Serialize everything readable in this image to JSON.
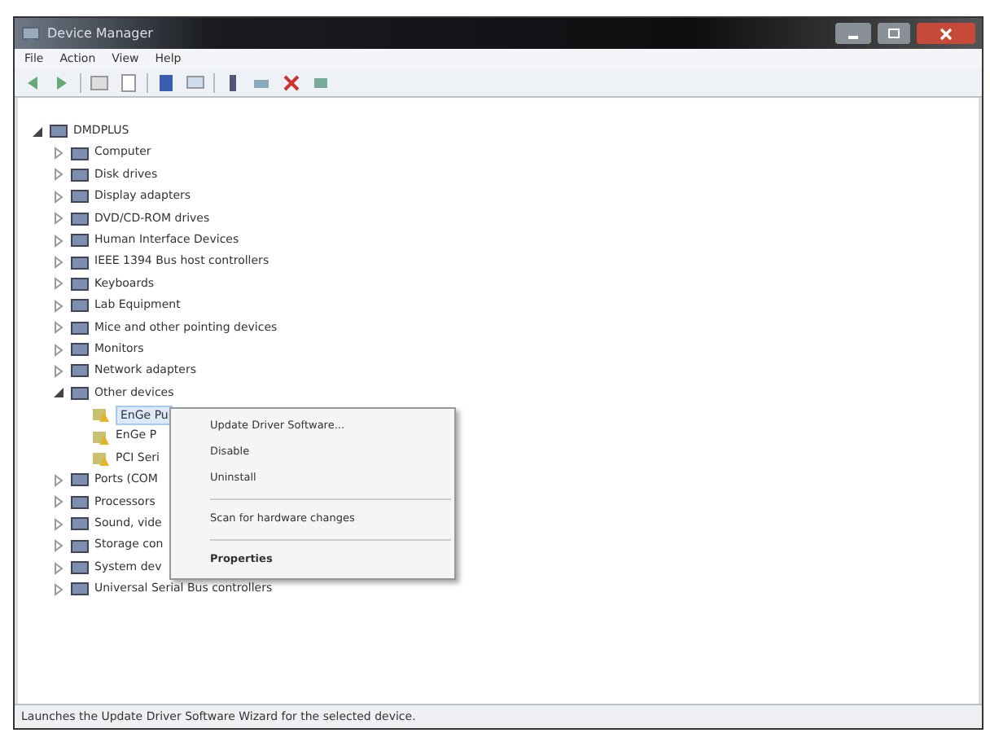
{
  "window": {
    "title": "Device Manager"
  },
  "menu_bar": [
    "File",
    "Action",
    "View",
    "Help"
  ],
  "tree": {
    "label": "DMDPLUS",
    "expanded": true,
    "selected": false,
    "children": [
      {
        "label": "Computer",
        "expanded": false,
        "selected": false
      },
      {
        "label": "Disk drives",
        "expanded": false,
        "selected": false
      },
      {
        "label": "Display adapters",
        "expanded": false,
        "selected": false
      },
      {
        "label": "DVD/CD-ROM drives",
        "expanded": false,
        "selected": false
      },
      {
        "label": "Human Interface Devices",
        "expanded": false,
        "selected": false
      },
      {
        "label": "IEEE 1394 Bus host controllers",
        "expanded": false,
        "selected": false
      },
      {
        "label": "Keyboards",
        "expanded": false,
        "selected": false
      },
      {
        "label": "Lab Equipment",
        "expanded": false,
        "selected": false
      },
      {
        "label": "Mice and other pointing devices",
        "expanded": false,
        "selected": false
      },
      {
        "label": "Monitors",
        "expanded": false,
        "selected": false
      },
      {
        "label": "Network adapters",
        "expanded": false,
        "selected": false
      },
      {
        "label": "Other devices",
        "expanded": true,
        "selected": false,
        "children": [
          {
            "label": "EnGe Pu",
            "warning": true,
            "selected": true
          },
          {
            "label": "EnGe P",
            "warning": true,
            "selected": false
          },
          {
            "label": "PCI Seri",
            "warning": true,
            "selected": false
          }
        ]
      },
      {
        "label": "Ports (COM",
        "expanded": false,
        "selected": false
      },
      {
        "label": "Processors",
        "expanded": false,
        "selected": false
      },
      {
        "label": "Sound, vide",
        "expanded": false,
        "selected": false
      },
      {
        "label": "Storage con",
        "expanded": false,
        "selected": false
      },
      {
        "label": "System dev",
        "expanded": false,
        "selected": false
      },
      {
        "label": "Universal Serial Bus controllers",
        "expanded": false,
        "selected": false
      }
    ]
  },
  "context_menu": [
    {
      "kind": "item",
      "label": "Update Driver Software...",
      "bold": false
    },
    {
      "kind": "item",
      "label": "Disable",
      "bold": false
    },
    {
      "kind": "item",
      "label": "Uninstall",
      "bold": false
    },
    {
      "kind": "separator"
    },
    {
      "kind": "item",
      "label": "Scan for hardware changes",
      "bold": false
    },
    {
      "kind": "separator"
    },
    {
      "kind": "item",
      "label": "Properties",
      "bold": true
    }
  ],
  "status_bar": "Launches the Update Driver Software Wizard for the selected device."
}
